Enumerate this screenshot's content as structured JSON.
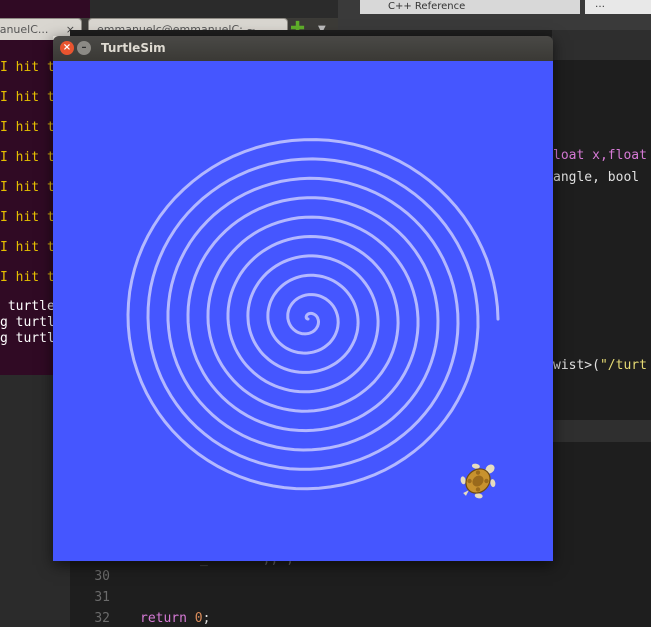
{
  "terminal": {
    "tab1_label": "manuelC...",
    "tab2_label": "emmanuelc@emmanuelC: ~",
    "tab_close_glyph": "×",
    "lines": [
      "I hit t",
      "I hit t",
      "I hit t",
      "I hit t",
      "I hit t",
      "I hit t",
      "I hit t",
      "I hit t"
    ],
    "tail_lines": [
      " turtle",
      "g turtl",
      "g turtl"
    ]
  },
  "editor": {
    "tab_label": "C++ Reference",
    "code_line_1": "loat x,float",
    "code_line_2": "angle, bool",
    "code_line_3_prefix": "wist>(",
    "code_line_3_str": "\"/turt",
    "partial_line": "_       ,, ;",
    "line_numbers": [
      "30",
      "31",
      "32"
    ],
    "return_kw": "return",
    "return_val": "0",
    "return_end": ";"
  },
  "turtlesim": {
    "title": "TurtleSim",
    "close_glyph": "×",
    "min_glyph": "–",
    "background_color": "#4556ff",
    "trail_color": "#b3b8ff",
    "turtle_heading_deg": 45
  }
}
